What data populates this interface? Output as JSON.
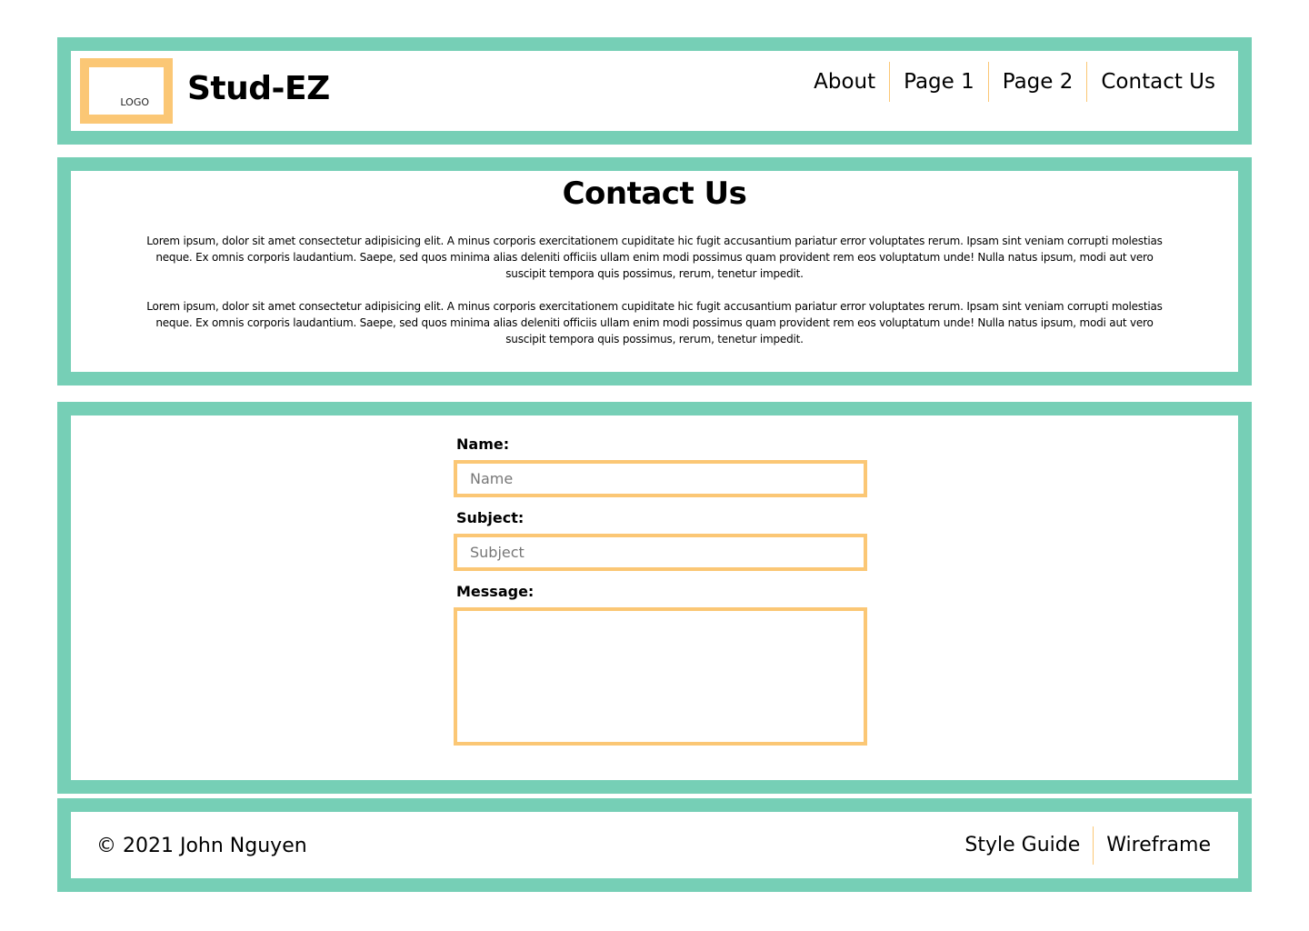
{
  "header": {
    "logo_text": "LOGO",
    "brand": "Stud-EZ",
    "nav": [
      "About",
      "Page 1",
      "Page 2",
      "Contact Us"
    ]
  },
  "intro": {
    "title": "Contact Us",
    "paragraphs": [
      "Lorem ipsum, dolor sit amet consectetur adipisicing elit. A minus corporis exercitationem cupiditate hic fugit accusantium pariatur error voluptates rerum. Ipsam sint veniam corrupti molestias neque. Ex omnis corporis laudantium. Saepe, sed quos minima alias deleniti officiis ullam enim modi possimus quam provident rem eos voluptatum unde! Nulla natus ipsum, modi aut vero suscipit tempora quis possimus, rerum, tenetur impedit.",
      "Lorem ipsum, dolor sit amet consectetur adipisicing elit. A minus corporis exercitationem cupiditate hic fugit accusantium pariatur error voluptates rerum. Ipsam sint veniam corrupti molestias neque. Ex omnis corporis laudantium. Saepe, sed quos minima alias deleniti officiis ullam enim modi possimus quam provident rem eos voluptatum unde! Nulla natus ipsum, modi aut vero suscipit tempora quis possimus, rerum, tenetur impedit."
    ]
  },
  "form": {
    "name_label": "Name:",
    "name_placeholder": "Name",
    "subject_label": "Subject:",
    "subject_placeholder": "Subject",
    "message_label": "Message:"
  },
  "footer": {
    "copyright": "© 2021 John Nguyen",
    "links": [
      "Style Guide",
      "Wireframe"
    ]
  },
  "colors": {
    "frame": "#76cfb6",
    "accent": "#fbc775"
  }
}
